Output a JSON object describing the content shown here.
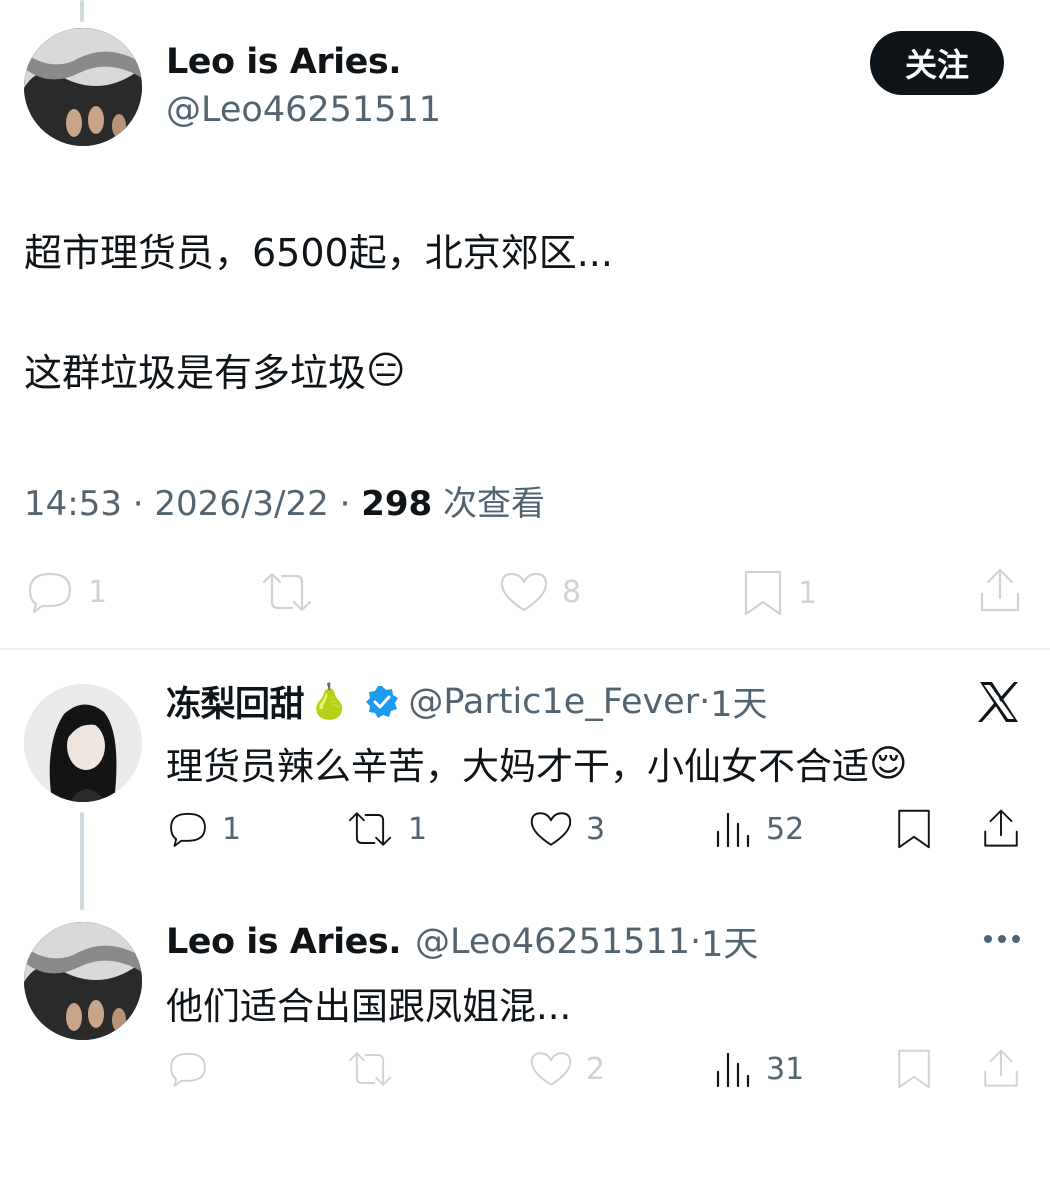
{
  "main_tweet": {
    "name": "Leo is Aries.",
    "handle": "@Leo46251511",
    "follow_label": "关注",
    "line1": "超市理货员，6500起，北京郊区...",
    "line2": "这群垃圾是有多垃圾",
    "line2_emoji": "😑",
    "time": "14:53",
    "date": "2026/3/22",
    "views": "298",
    "views_label": "次查看",
    "actions": {
      "reply": "1",
      "retweet": "",
      "like": "8",
      "bookmark": "1"
    }
  },
  "reply1": {
    "name": "冻梨回甜",
    "name_emoji": "🍐",
    "handle": "@Partic1e_Fever",
    "time": "1天",
    "text": "理货员辣么辛苦，大妈才干，小仙女不合适",
    "text_emoji": "😌",
    "actions": {
      "reply": "1",
      "retweet": "1",
      "like": "3",
      "views": "52"
    }
  },
  "reply2": {
    "name": "Leo is Aries.",
    "handle": "@Leo46251511",
    "time": "1天",
    "text": "他们适合出国跟凤姐混...",
    "actions": {
      "reply": "",
      "retweet": "",
      "like": "2",
      "views": "31"
    }
  },
  "colors": {
    "text": "#0f1419",
    "secondary": "#536471",
    "faint": "#cdd3d8",
    "verified": "#1d9bf0"
  }
}
